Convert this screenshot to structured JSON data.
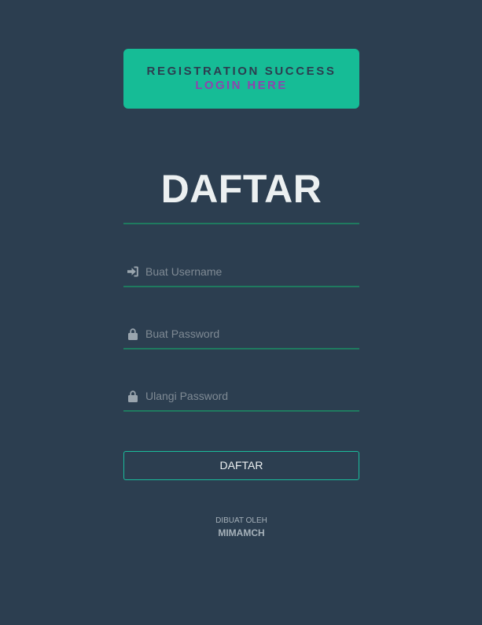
{
  "alert": {
    "message": "REGISTRATION SUCCESS",
    "link_text": "LOGIN HERE",
    "background_color": "#16bc96",
    "link_color": "#8e44ad"
  },
  "form": {
    "title": "DAFTAR",
    "fields": [
      {
        "icon": "sign-in-icon",
        "placeholder": "Buat Username",
        "value": ""
      },
      {
        "icon": "lock-icon",
        "placeholder": "Buat Password",
        "value": ""
      },
      {
        "icon": "lock-icon",
        "placeholder": "Ulangi Password",
        "value": ""
      }
    ],
    "submit_label": "DAFTAR",
    "accent_color": "#1abc9c"
  },
  "footer": {
    "credit_label": "DIBUAT OLEH",
    "author": "MIMAMCH"
  },
  "theme": {
    "background": "#2c3e50",
    "text": "#ecf0f1"
  }
}
